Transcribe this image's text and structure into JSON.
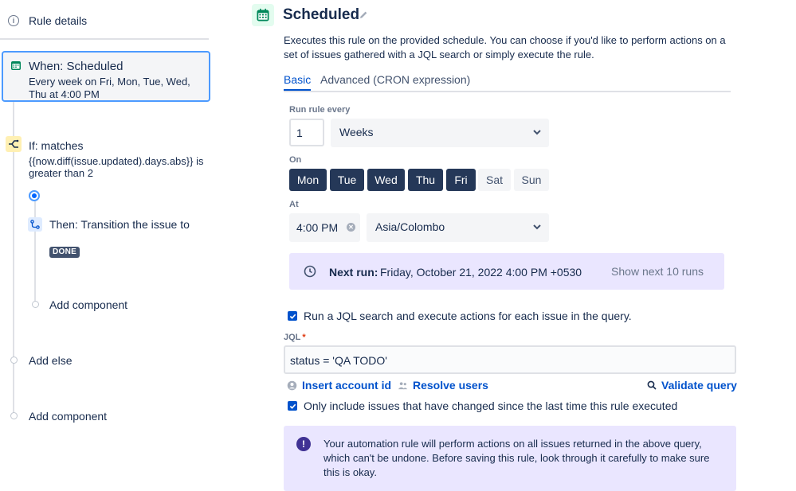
{
  "left": {
    "rule_details": "Rule details",
    "when": {
      "title": "When: Scheduled",
      "summary": "Every week on Fri, Mon, Tue, Wed, Thu at 4:00 PM"
    },
    "if": {
      "title": "If: matches",
      "condition": "{{now.diff(issue.updated).days.abs}} is greater than 2"
    },
    "then": {
      "title": "Then: Transition the issue to",
      "status": "DONE"
    },
    "add_component_inner": "Add component",
    "add_else": "Add else",
    "add_component_outer": "Add component"
  },
  "header": {
    "title": "Scheduled",
    "description": "Executes this rule on the provided schedule. You can choose if you'd like to perform actions on a set of issues gathered with a JQL search or simply execute the rule."
  },
  "tabs": [
    "Basic",
    "Advanced (CRON expression)"
  ],
  "active_tab": "Basic",
  "schedule": {
    "run_every_label": "Run rule every",
    "interval_value": "1",
    "interval_unit": "Weeks",
    "on_label": "On",
    "days": [
      {
        "label": "Mon",
        "selected": true
      },
      {
        "label": "Tue",
        "selected": true
      },
      {
        "label": "Wed",
        "selected": true
      },
      {
        "label": "Thu",
        "selected": true
      },
      {
        "label": "Fri",
        "selected": true
      },
      {
        "label": "Sat",
        "selected": false
      },
      {
        "label": "Sun",
        "selected": false
      }
    ],
    "at_label": "At",
    "time": "4:00 PM",
    "timezone": "Asia/Colombo"
  },
  "next_run": {
    "label": "Next run:",
    "value": "Friday, October 21, 2022 4:00 PM +0530",
    "show_more": "Show next 10 runs"
  },
  "jql": {
    "run_search_checkbox": "Run a JQL search and execute actions for each issue in the query.",
    "run_search_checked": true,
    "label": "JQL",
    "required_mark": "*",
    "query": "status = 'QA TODO'",
    "insert_account_id": "Insert account id",
    "resolve_users": "Resolve users",
    "validate_query": "Validate query",
    "only_changed_checkbox": "Only include issues that have changed since the last time this rule executed",
    "only_changed_checked": true
  },
  "warning": {
    "message": "Your automation rule will perform actions on all issues returned in the above query, which can't be undone. Before saving this rule, look through it carefully to make sure this is okay."
  },
  "colors": {
    "primary": "#0052cc",
    "selected_day": "#253858",
    "info_bg": "#eae6ff",
    "focus_border": "#4c9aff"
  }
}
